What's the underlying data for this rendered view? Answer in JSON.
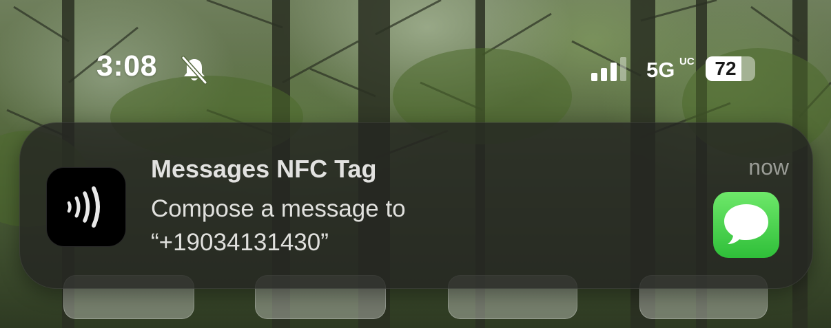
{
  "status_bar": {
    "time": "3:08",
    "silent_icon": "bell-slash-icon",
    "signal_bars": 3,
    "signal_bars_total": 4,
    "network": "5G",
    "network_suffix": "UC",
    "battery_percent": "72",
    "battery_level": 0.72
  },
  "notification": {
    "app_icon": "nfc-tag-icon",
    "title": "Messages NFC Tag",
    "body": "Compose a message to\n“+19034131430”",
    "time": "now",
    "attachment_icon": "messages-app-icon",
    "colors": {
      "messages_green": "#34c759"
    }
  }
}
